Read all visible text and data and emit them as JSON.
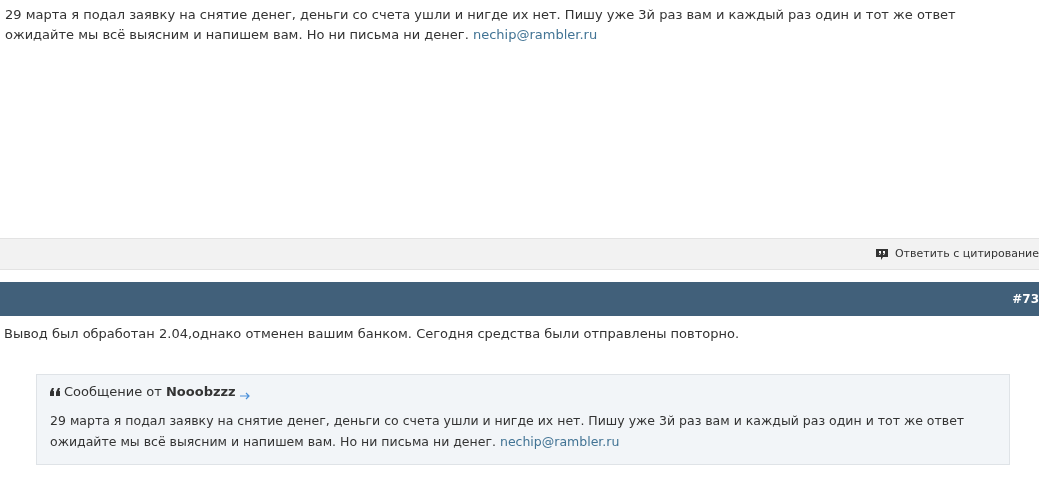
{
  "post_1": {
    "text": "29 марта я подал заявку на снятие денег, деньги со счета ушли и нигде их нет. Пишу уже 3й раз вам и каждый раз один и тот же ответ ожидайте мы всё выясним и напишем вам. Но ни письма ни денег.",
    "email": "nechip@rambler.ru"
  },
  "post_1_footer": {
    "reply_quote_button": "Ответить с цитирование"
  },
  "post_2": {
    "number": "#73",
    "text": "Вывод был обработан 2.04,однако отменен вашим банком. Сегодня средства были отправлены повторно.",
    "quote": {
      "header": "Сообщение от **Nooobzzz**",
      "text": "29 марта я подал заявку на снятие денег, деньги со счета ушли и нигде их нет. Пишу уже 3й раз вам и каждый раз один и тот же ответ ожидайте мы всё выясним и напишем вам. Но ни письма ни денег.",
      "email": "nechip@rambler.ru"
    }
  }
}
